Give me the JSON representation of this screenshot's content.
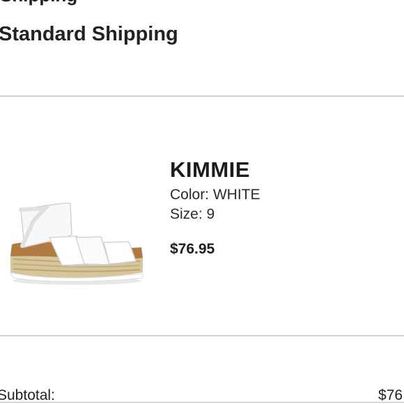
{
  "shipping": {
    "section_title_partial": "Shipping",
    "method": "Standard Shipping"
  },
  "item": {
    "image_icon": "sandal-product-image",
    "name": "KIMMIE",
    "color_text": "Color: WHITE",
    "size_text": "Size: 9",
    "price": "$76.95"
  },
  "summary": {
    "subtotal_label": "Subtotal:",
    "subtotal_value": "$76"
  }
}
